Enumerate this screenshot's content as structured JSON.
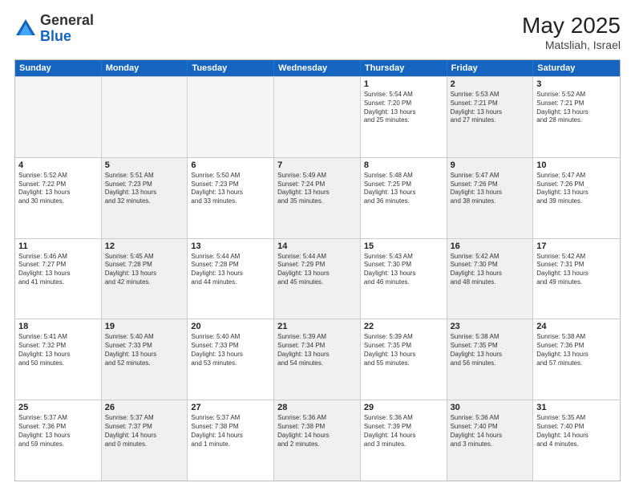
{
  "header": {
    "logo_general": "General",
    "logo_blue": "Blue",
    "month_year": "May 2025",
    "location": "Matsliah, Israel"
  },
  "weekdays": [
    "Sunday",
    "Monday",
    "Tuesday",
    "Wednesday",
    "Thursday",
    "Friday",
    "Saturday"
  ],
  "rows": [
    [
      {
        "day": "",
        "text": "",
        "empty": true
      },
      {
        "day": "",
        "text": "",
        "empty": true
      },
      {
        "day": "",
        "text": "",
        "empty": true
      },
      {
        "day": "",
        "text": "",
        "empty": true
      },
      {
        "day": "1",
        "text": "Sunrise: 5:54 AM\nSunset: 7:20 PM\nDaylight: 13 hours\nand 25 minutes."
      },
      {
        "day": "2",
        "text": "Sunrise: 5:53 AM\nSunset: 7:21 PM\nDaylight: 13 hours\nand 27 minutes.",
        "shaded": true
      },
      {
        "day": "3",
        "text": "Sunrise: 5:52 AM\nSunset: 7:21 PM\nDaylight: 13 hours\nand 28 minutes."
      }
    ],
    [
      {
        "day": "4",
        "text": "Sunrise: 5:52 AM\nSunset: 7:22 PM\nDaylight: 13 hours\nand 30 minutes."
      },
      {
        "day": "5",
        "text": "Sunrise: 5:51 AM\nSunset: 7:23 PM\nDaylight: 13 hours\nand 32 minutes.",
        "shaded": true
      },
      {
        "day": "6",
        "text": "Sunrise: 5:50 AM\nSunset: 7:23 PM\nDaylight: 13 hours\nand 33 minutes."
      },
      {
        "day": "7",
        "text": "Sunrise: 5:49 AM\nSunset: 7:24 PM\nDaylight: 13 hours\nand 35 minutes.",
        "shaded": true
      },
      {
        "day": "8",
        "text": "Sunrise: 5:48 AM\nSunset: 7:25 PM\nDaylight: 13 hours\nand 36 minutes."
      },
      {
        "day": "9",
        "text": "Sunrise: 5:47 AM\nSunset: 7:26 PM\nDaylight: 13 hours\nand 38 minutes.",
        "shaded": true
      },
      {
        "day": "10",
        "text": "Sunrise: 5:47 AM\nSunset: 7:26 PM\nDaylight: 13 hours\nand 39 minutes."
      }
    ],
    [
      {
        "day": "11",
        "text": "Sunrise: 5:46 AM\nSunset: 7:27 PM\nDaylight: 13 hours\nand 41 minutes."
      },
      {
        "day": "12",
        "text": "Sunrise: 5:45 AM\nSunset: 7:28 PM\nDaylight: 13 hours\nand 42 minutes.",
        "shaded": true
      },
      {
        "day": "13",
        "text": "Sunrise: 5:44 AM\nSunset: 7:28 PM\nDaylight: 13 hours\nand 44 minutes."
      },
      {
        "day": "14",
        "text": "Sunrise: 5:44 AM\nSunset: 7:29 PM\nDaylight: 13 hours\nand 45 minutes.",
        "shaded": true
      },
      {
        "day": "15",
        "text": "Sunrise: 5:43 AM\nSunset: 7:30 PM\nDaylight: 13 hours\nand 46 minutes."
      },
      {
        "day": "16",
        "text": "Sunrise: 5:42 AM\nSunset: 7:30 PM\nDaylight: 13 hours\nand 48 minutes.",
        "shaded": true
      },
      {
        "day": "17",
        "text": "Sunrise: 5:42 AM\nSunset: 7:31 PM\nDaylight: 13 hours\nand 49 minutes."
      }
    ],
    [
      {
        "day": "18",
        "text": "Sunrise: 5:41 AM\nSunset: 7:32 PM\nDaylight: 13 hours\nand 50 minutes."
      },
      {
        "day": "19",
        "text": "Sunrise: 5:40 AM\nSunset: 7:33 PM\nDaylight: 13 hours\nand 52 minutes.",
        "shaded": true
      },
      {
        "day": "20",
        "text": "Sunrise: 5:40 AM\nSunset: 7:33 PM\nDaylight: 13 hours\nand 53 minutes."
      },
      {
        "day": "21",
        "text": "Sunrise: 5:39 AM\nSunset: 7:34 PM\nDaylight: 13 hours\nand 54 minutes.",
        "shaded": true
      },
      {
        "day": "22",
        "text": "Sunrise: 5:39 AM\nSunset: 7:35 PM\nDaylight: 13 hours\nand 55 minutes."
      },
      {
        "day": "23",
        "text": "Sunrise: 5:38 AM\nSunset: 7:35 PM\nDaylight: 13 hours\nand 56 minutes.",
        "shaded": true
      },
      {
        "day": "24",
        "text": "Sunrise: 5:38 AM\nSunset: 7:36 PM\nDaylight: 13 hours\nand 57 minutes."
      }
    ],
    [
      {
        "day": "25",
        "text": "Sunrise: 5:37 AM\nSunset: 7:36 PM\nDaylight: 13 hours\nand 59 minutes."
      },
      {
        "day": "26",
        "text": "Sunrise: 5:37 AM\nSunset: 7:37 PM\nDaylight: 14 hours\nand 0 minutes.",
        "shaded": true
      },
      {
        "day": "27",
        "text": "Sunrise: 5:37 AM\nSunset: 7:38 PM\nDaylight: 14 hours\nand 1 minute."
      },
      {
        "day": "28",
        "text": "Sunrise: 5:36 AM\nSunset: 7:38 PM\nDaylight: 14 hours\nand 2 minutes.",
        "shaded": true
      },
      {
        "day": "29",
        "text": "Sunrise: 5:36 AM\nSunset: 7:39 PM\nDaylight: 14 hours\nand 3 minutes."
      },
      {
        "day": "30",
        "text": "Sunrise: 5:36 AM\nSunset: 7:40 PM\nDaylight: 14 hours\nand 3 minutes.",
        "shaded": true
      },
      {
        "day": "31",
        "text": "Sunrise: 5:35 AM\nSunset: 7:40 PM\nDaylight: 14 hours\nand 4 minutes."
      }
    ]
  ]
}
